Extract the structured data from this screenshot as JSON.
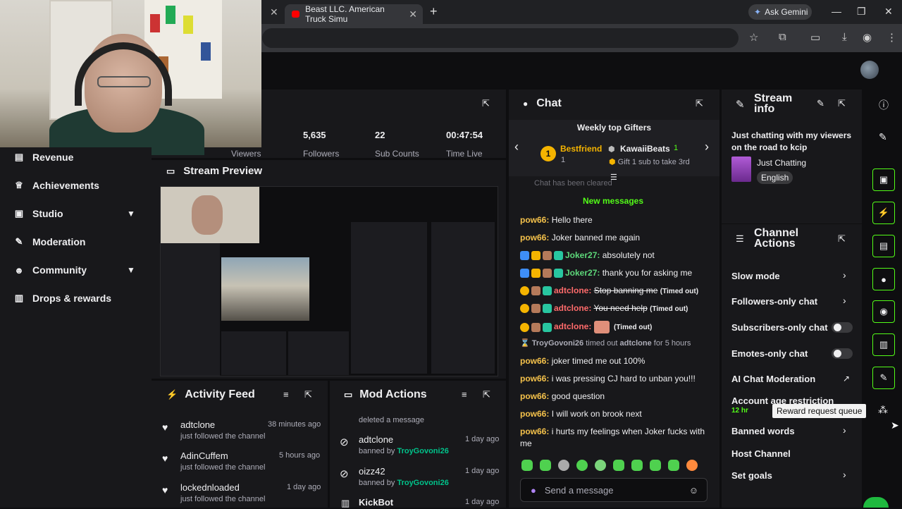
{
  "browser": {
    "tab_title": "Beast LLC. American Truck Simu",
    "new_tab_symbol": "+",
    "gemini_label": "Ask Gemini"
  },
  "sidebar": {
    "items": [
      {
        "label": "Revenue",
        "icon": "revenue-icon"
      },
      {
        "label": "Achievements",
        "icon": "trophy-icon"
      },
      {
        "label": "Studio",
        "icon": "camera-icon",
        "expandable": true
      },
      {
        "label": "Moderation",
        "icon": "wrench-icon"
      },
      {
        "label": "Community",
        "icon": "people-icon",
        "expandable": true
      },
      {
        "label": "Drops & rewards",
        "icon": "gift-icon"
      }
    ]
  },
  "stats": [
    {
      "value": "5,635",
      "label": "Followers"
    },
    {
      "value": "22",
      "label": "Sub Counts"
    },
    {
      "value": "00:47:54",
      "label": "Time Live"
    }
  ],
  "stats_partial_label": "Viewers",
  "preview": {
    "title": "Stream Preview"
  },
  "activity": {
    "title": "Activity Feed",
    "items": [
      {
        "name": "adtclone",
        "action": "just followed the channel",
        "time": "38 minutes ago"
      },
      {
        "name": "AdinCuffem",
        "action": "just followed the channel",
        "time": "5 hours ago"
      },
      {
        "name": "lockednloaded",
        "action": "just followed the channel",
        "time": "1 day ago"
      }
    ]
  },
  "mod_actions": {
    "title": "Mod Actions",
    "top_text": "deleted a message",
    "items": [
      {
        "name": "adtclone",
        "action": "banned by",
        "by": "TroyGovoni26",
        "time": "1 day ago"
      },
      {
        "name": "oizz42",
        "action": "banned by",
        "by": "TroyGovoni26",
        "time": "1 day ago"
      },
      {
        "name": "KickBot",
        "time": "1 day ago"
      }
    ]
  },
  "chat": {
    "title": "Chat",
    "gifters_title": "Weekly top Gifters",
    "gifter1": "Bestfriend",
    "gifter1_count": "1",
    "gifter2": "KawaiiBeats",
    "gifter2_count": "1",
    "gift_prompt": "Gift 1 sub to take 3rd",
    "cleared_text": "Chat has been cleared",
    "new_messages": "New messages",
    "messages": [
      {
        "user": "pow66:",
        "text": "Hello there"
      },
      {
        "user": "pow66:",
        "text": "Joker banned me again"
      },
      {
        "user": "Joker27:",
        "text": "absolutely not"
      },
      {
        "user": "Joker27:",
        "text": "thank you for asking me"
      },
      {
        "user": "adtclone:",
        "text": "Stop banning me",
        "suffix": "(Timed out)"
      },
      {
        "user": "adtclone:",
        "text": "You need help",
        "suffix": "(Timed out)"
      },
      {
        "user": "adtclone:",
        "text": "",
        "suffix": "(Timed out)"
      },
      {
        "user": "pow66:",
        "text": "joker timed me out 100%"
      },
      {
        "user": "pow66:",
        "text": "i was pressing CJ hard to unban you!!!"
      },
      {
        "user": "pow66:",
        "text": "good question"
      },
      {
        "user": "pow66:",
        "text": "I will work on brook next"
      },
      {
        "user": "pow66:",
        "text": "i hurts my feelings when Joker fucks with"
      },
      {
        "text": "me"
      }
    ],
    "timeout_notice_user": "TroyGovoni26",
    "timeout_notice_mid": "timed out",
    "timeout_notice_target": "adtclone",
    "timeout_notice_end": "for 5 hours",
    "input_placeholder": "Send a message"
  },
  "stream_info": {
    "title_line1": "Stream",
    "title_line2": "info",
    "stream_title": "Just chatting with my viewers on the road to kcip",
    "category": "Just Chatting",
    "language": "English"
  },
  "channel_actions": {
    "title_line1": "Channel",
    "title_line2": "Actions",
    "items": [
      {
        "label": "Slow mode",
        "control": "arrow"
      },
      {
        "label": "Followers-only chat",
        "control": "arrow"
      },
      {
        "label": "Subscribers-only chat",
        "control": "toggle",
        "on": false
      },
      {
        "label": "Emotes-only chat",
        "control": "toggle",
        "on": false
      },
      {
        "label": "AI Chat Moderation",
        "control": "external"
      },
      {
        "label": "Account age restriction",
        "control": "none"
      },
      {
        "label": "Banned words",
        "control": "arrow"
      },
      {
        "label": "Host Channel",
        "control": "none"
      },
      {
        "label": "Set goals",
        "control": "arrow"
      }
    ],
    "account_age_value": "12 hr"
  },
  "tooltip": "Reward request queue",
  "colors": {
    "accent": "#53fc18",
    "panel": "#18181b",
    "bg": "#0e0e10",
    "username_green": "#00c28a"
  }
}
